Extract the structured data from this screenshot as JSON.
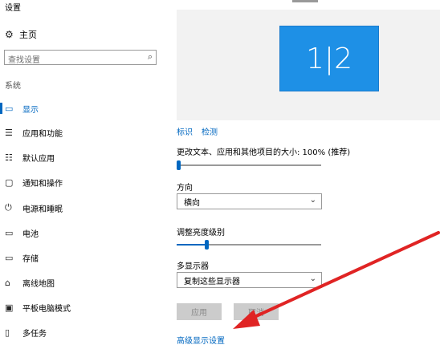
{
  "window": {
    "title": "设置"
  },
  "sidebar": {
    "home_label": "主页",
    "search_placeholder": "查找设置",
    "section_label": "系统",
    "items": [
      {
        "label": "显示",
        "icon": "monitor-icon",
        "active": true
      },
      {
        "label": "应用和功能",
        "icon": "apps-list-icon"
      },
      {
        "label": "默认应用",
        "icon": "default-apps-icon"
      },
      {
        "label": "通知和操作",
        "icon": "notification-icon"
      },
      {
        "label": "电源和睡眠",
        "icon": "power-icon"
      },
      {
        "label": "电池",
        "icon": "battery-icon"
      },
      {
        "label": "存储",
        "icon": "storage-icon"
      },
      {
        "label": "离线地图",
        "icon": "map-icon"
      },
      {
        "label": "平板电脑模式",
        "icon": "tablet-icon"
      },
      {
        "label": "多任务",
        "icon": "multitask-icon"
      }
    ]
  },
  "main": {
    "monitor_label": "1|2",
    "identify_link": "标识",
    "detect_link": "检测",
    "scale_label": "更改文本、应用和其他项目的大小: 100% (推荐)",
    "scale_value_fraction": 0.0,
    "orientation_label": "方向",
    "orientation_value": "横向",
    "brightness_label": "调整亮度级别",
    "brightness_value_fraction": 0.2,
    "multi_display_label": "多显示器",
    "multi_display_value": "复制这些显示器",
    "apply_button": "应用",
    "cancel_button": "取消",
    "advanced_link": "高级显示设置"
  },
  "colors": {
    "accent": "#0067c0",
    "monitor_fill": "#1e90e6",
    "annotation_arrow": "#e02424"
  }
}
